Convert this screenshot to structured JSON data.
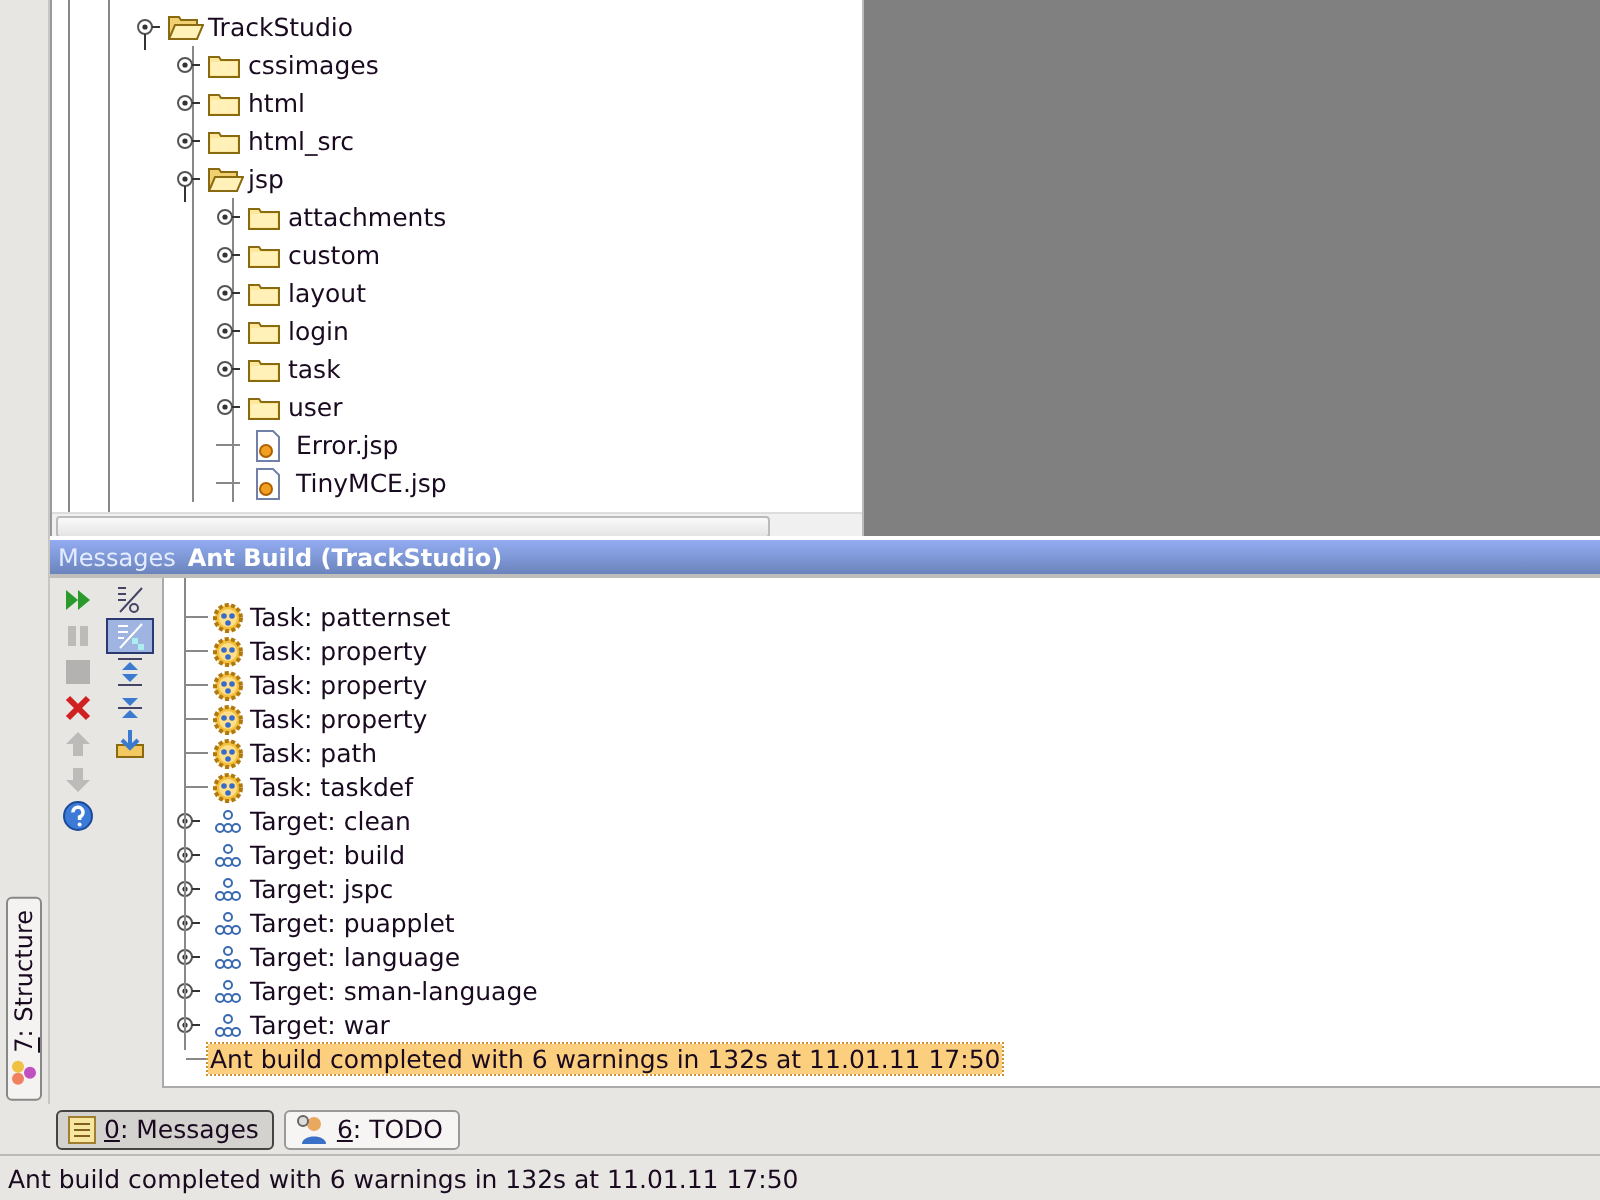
{
  "side_tabs": [
    {
      "key": "7",
      "label": ": Structure",
      "selected": false
    }
  ],
  "project_tree": {
    "items": [
      {
        "label": "TrackStudio",
        "kind": "folder",
        "expanded": true,
        "children": [
          {
            "label": "cssimages",
            "kind": "folder",
            "expanded": false
          },
          {
            "label": "html",
            "kind": "folder",
            "expanded": false
          },
          {
            "label": "html_src",
            "kind": "folder",
            "expanded": false
          },
          {
            "label": "jsp",
            "kind": "folder",
            "expanded": true,
            "children": [
              {
                "label": "attachments",
                "kind": "folder",
                "expanded": false
              },
              {
                "label": "custom",
                "kind": "folder",
                "expanded": false
              },
              {
                "label": "layout",
                "kind": "folder",
                "expanded": false
              },
              {
                "label": "login",
                "kind": "folder",
                "expanded": false
              },
              {
                "label": "task",
                "kind": "folder",
                "expanded": false
              },
              {
                "label": "user",
                "kind": "folder",
                "expanded": false
              },
              {
                "label": "Error.jsp",
                "kind": "file"
              },
              {
                "label": "TinyMCE.jsp",
                "kind": "file"
              }
            ]
          }
        ]
      }
    ]
  },
  "messages": {
    "title": "Messages",
    "subtitle": "Ant Build (TrackStudio)",
    "toolbar_left": [
      {
        "kind": "run",
        "disabled": false
      },
      {
        "kind": "pause",
        "disabled": true
      },
      {
        "kind": "stop",
        "disabled": true
      },
      {
        "kind": "close",
        "disabled": false
      },
      {
        "kind": "up",
        "disabled": true
      },
      {
        "kind": "down",
        "disabled": true
      },
      {
        "kind": "help",
        "disabled": false
      }
    ],
    "toolbar_right": [
      {
        "kind": "sort",
        "on": false
      },
      {
        "kind": "filter",
        "on": true
      },
      {
        "kind": "expand",
        "on": false
      },
      {
        "kind": "collapse",
        "on": false
      },
      {
        "kind": "export",
        "on": false
      }
    ],
    "rows": [
      {
        "kind": "task",
        "text": "Task: patternset",
        "selected": false
      },
      {
        "kind": "task",
        "text": "Task: property",
        "selected": false
      },
      {
        "kind": "task",
        "text": "Task: property",
        "selected": false
      },
      {
        "kind": "task",
        "text": "Task: property",
        "selected": false
      },
      {
        "kind": "task",
        "text": "Task: path",
        "selected": false
      },
      {
        "kind": "task",
        "text": "Task: taskdef",
        "selected": false
      },
      {
        "kind": "target",
        "text": "Target: clean",
        "selected": false
      },
      {
        "kind": "target",
        "text": "Target: build",
        "selected": false
      },
      {
        "kind": "target",
        "text": "Target: jspc",
        "selected": false
      },
      {
        "kind": "target",
        "text": "Target: puapplet",
        "selected": false
      },
      {
        "kind": "target",
        "text": "Target: language",
        "selected": false
      },
      {
        "kind": "target",
        "text": "Target: sman-language",
        "selected": false
      },
      {
        "kind": "target",
        "text": "Target: war",
        "selected": false
      },
      {
        "kind": "message",
        "text": "Ant build completed with 6 warnings in 132s at 11.01.11 17:50",
        "selected": true
      }
    ]
  },
  "bottom_tabs": [
    {
      "kind": "messages",
      "key": "0",
      "label": ": Messages",
      "selected": true
    },
    {
      "kind": "todo",
      "key": "6",
      "label": ": TODO",
      "selected": false
    }
  ],
  "status_bar": "Ant build completed with 6 warnings in 132s at 11.01.11 17:50"
}
